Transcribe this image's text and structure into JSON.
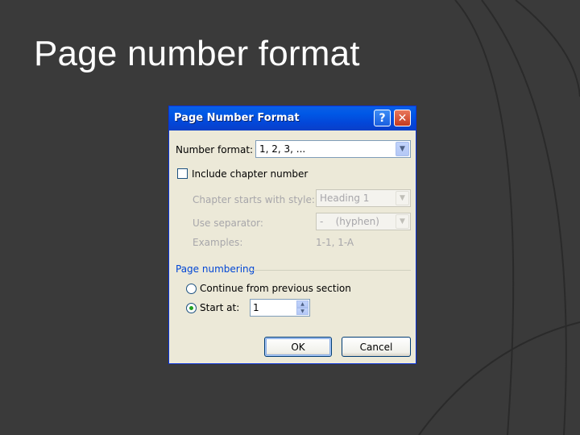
{
  "slide": {
    "title": "Page number format"
  },
  "dialog": {
    "title": "Page Number Format",
    "help_glyph": "?",
    "close_glyph": "✕",
    "number_format": {
      "label": "Number format:",
      "value": "1, 2, 3, ..."
    },
    "include_chapter": {
      "label": "Include chapter number",
      "checked": false
    },
    "chapter_style": {
      "label": "Chapter starts with style:",
      "value": "Heading 1"
    },
    "separator": {
      "label": "Use separator:",
      "value": "-    (hyphen)"
    },
    "examples": {
      "label": "Examples:",
      "value": "1-1, 1-A"
    },
    "page_numbering": {
      "group_label": "Page numbering",
      "continue_label": "Continue from previous section",
      "start_at_label": "Start at:",
      "start_at_value": "1",
      "selected": "start_at"
    },
    "ok_label": "OK",
    "cancel_label": "Cancel"
  },
  "colors": {
    "slide_background": "#3a3a3a",
    "title_text": "#ffffff",
    "dialog_face": "#ece9d8",
    "titlebar_blue": "#0058e6",
    "group_label_blue": "#0046d5",
    "disabled_text": "#a7a6aa"
  }
}
